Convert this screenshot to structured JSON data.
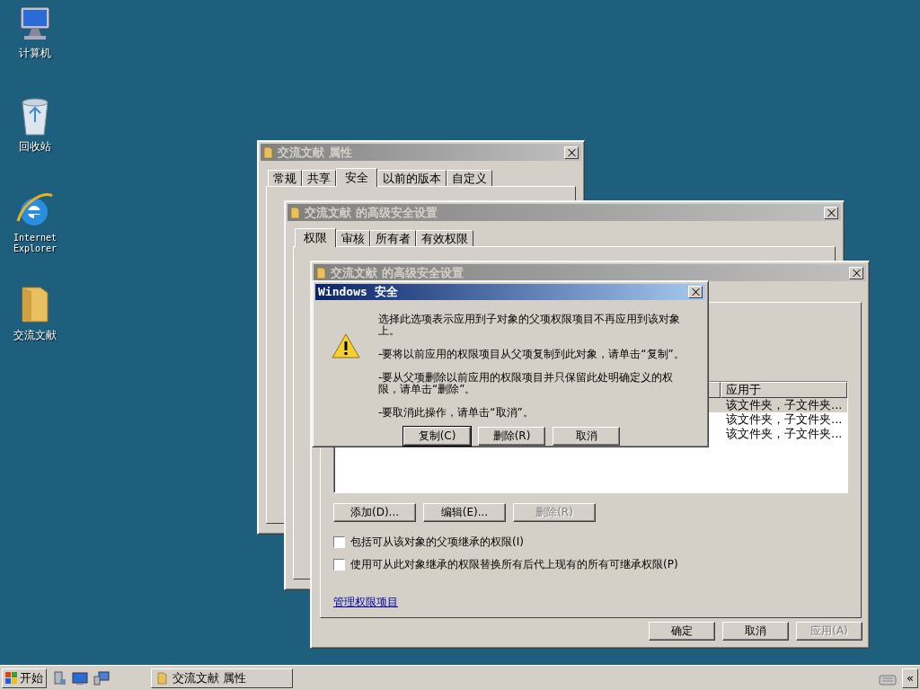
{
  "desktop_icons": [
    {
      "label": "计算机",
      "kind": "computer"
    },
    {
      "label": "回收站",
      "kind": "recycle"
    },
    {
      "label": "Internet Explorer",
      "kind": "browser"
    },
    {
      "label": "交流文献",
      "kind": "folder"
    }
  ],
  "windows": [
    {
      "title": "交流文献 属性",
      "active": false,
      "tabs": [
        {
          "label": "常规",
          "selected": false
        },
        {
          "label": "共享",
          "selected": false
        },
        {
          "label": "安全",
          "selected": true
        },
        {
          "label": "以前的版本",
          "selected": false
        },
        {
          "label": "自定义",
          "selected": false
        }
      ]
    },
    {
      "title": "交流文献 的高级安全设置",
      "active": false,
      "tabs": [
        {
          "label": "权限",
          "selected": true
        },
        {
          "label": "审核",
          "selected": false
        },
        {
          "label": "所有者",
          "selected": false
        },
        {
          "label": "有效权限",
          "selected": false
        }
      ]
    },
    {
      "title": "交流文献 的高级安全设置",
      "active": false,
      "table": {
        "columns": [
          "应用于"
        ],
        "rows": [
          {
            "cells": [
              "该文件夹，子文件夹..."
            ],
            "selected": true
          },
          {
            "cells": [
              "该文件夹，子文件夹..."
            ],
            "selected": false
          },
          {
            "cells": [
              "该文件夹，子文件夹..."
            ],
            "selected": false
          }
        ]
      },
      "entry_buttons": [
        {
          "label": "添加(D)...",
          "disabled": false
        },
        {
          "label": "编辑(E)...",
          "disabled": false
        },
        {
          "label": "删除(R)",
          "disabled": true
        }
      ],
      "checkboxes": [
        {
          "label": "包括可从该对象的父项继承的权限(I)",
          "checked": false
        },
        {
          "label": "使用可从此对象继承的权限替换所有后代上现有的所有可继承权限(P)",
          "checked": false
        }
      ],
      "link": "管理权限项目",
      "footer_buttons": [
        {
          "label": "确定",
          "disabled": false
        },
        {
          "label": "取消",
          "disabled": false
        },
        {
          "label": "应用(A)",
          "disabled": true
        }
      ]
    }
  ],
  "dialog": {
    "title": "Windows 安全",
    "active": true,
    "paragraphs": [
      "选择此选项表示应用到子对象的父项权限项目不再应用到该对象上。",
      "-要将以前应用的权限项目从父项复制到此对象，请单击“复制”。",
      "-要从父项删除以前应用的权限项目并只保留此处明确定义的权限，请单击“删除”。",
      "-要取消此操作，请单击“取消”。"
    ],
    "buttons": [
      {
        "label": "复制(C)",
        "default": true
      },
      {
        "label": "删除(R)",
        "default": false
      },
      {
        "label": "取消",
        "default": false
      }
    ]
  },
  "taskbar": {
    "start": "开始",
    "tasks": [
      {
        "label": "交流文献 属性"
      }
    ],
    "tray_toggle": "«"
  }
}
